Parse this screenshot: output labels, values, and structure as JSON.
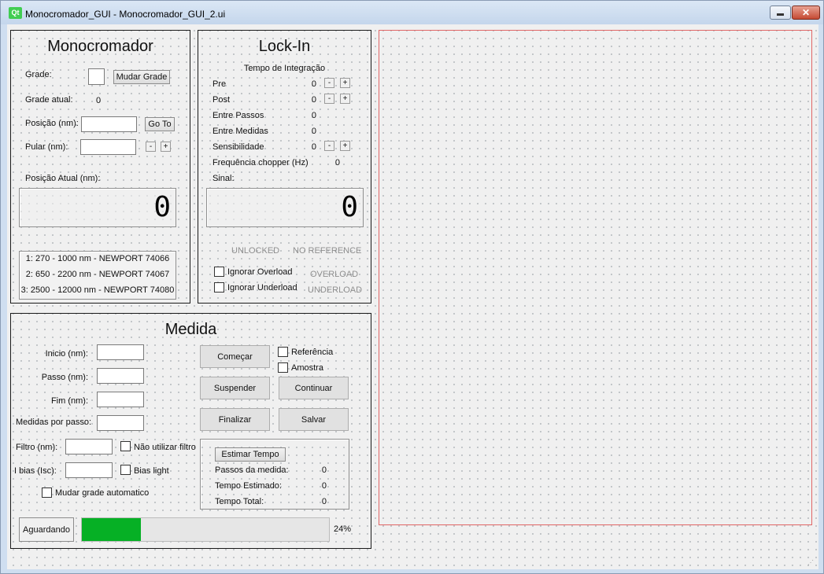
{
  "window": {
    "title": "Monocromador_GUI - Monocromador_GUI_2.ui",
    "logo": "Qt",
    "close": "✕"
  },
  "mono": {
    "title": "Monocromador",
    "grade_label": "Grade:",
    "mudar_grade": "Mudar Grade",
    "grade_atual_label": "Grade atual:",
    "grade_atual_value": "0",
    "posicao_label": "Posição (nm):",
    "goto": "Go To",
    "pular_label": "Pular (nm):",
    "minus": "-",
    "plus": "+",
    "posicao_atual_label": "Posição Atual (nm):",
    "lcd_value": "0",
    "gratings": [
      "1: 270 - 1000 nm - NEWPORT 74066",
      "2: 650 - 2200 nm - NEWPORT 74067",
      "3: 2500 - 12000 nm - NEWPORT 74080"
    ]
  },
  "lockin": {
    "title": "Lock-In",
    "tempo_label": "Tempo de Integração",
    "pre_label": "Pre",
    "pre_value": "0",
    "post_label": "Post",
    "post_value": "0",
    "entre_passos_label": "Entre Passos",
    "entre_passos_value": "0",
    "entre_medidas_label": "Entre Medidas",
    "entre_medidas_value": "0",
    "sens_label": "Sensibilidade",
    "sens_value": "0",
    "freq_label": "Frequência chopper (Hz)",
    "freq_value": "0",
    "sinal_label": "Sinal:",
    "lcd_value": "0",
    "unlocked": "UNLOCKED",
    "no_reference": "NO REFERENCE",
    "ignorar_overload": "Ignorar Overload",
    "overload": "OVERLOAD",
    "ignorar_underload": "Ignorar Underload",
    "underload": "UNDERLOAD",
    "minus": "-",
    "plus": "+"
  },
  "medida": {
    "title": "Medida",
    "inicio_label": "Inicio (nm):",
    "passo_label": "Passo (nm):",
    "fim_label": "Fim (nm):",
    "medidas_label": "Medidas por passo:",
    "filtro_label": "Filtro (nm):",
    "nao_filtro": "Não utilizar filtro",
    "ibias_label": "I bias (Isc):",
    "bias_light": "Bias light",
    "mudar_auto": "Mudar grade automatico",
    "comecar": "Começar",
    "referencia": "Referência",
    "amostra": "Amostra",
    "suspender": "Suspender",
    "continuar": "Continuar",
    "finalizar": "Finalizar",
    "salvar": "Salvar",
    "estimar": "Estimar Tempo",
    "passos_label": "Passos da medida:",
    "passos_value": "0",
    "tempo_est_label": "Tempo Estimado:",
    "tempo_est_value": "0",
    "tempo_total_label": "Tempo Total:",
    "tempo_total_value": "0",
    "status": "Aguardando",
    "progress_percent": 24,
    "progress_text": "24%"
  },
  "colors": {
    "progress": "#06b025",
    "plot_border": "#e06666"
  }
}
